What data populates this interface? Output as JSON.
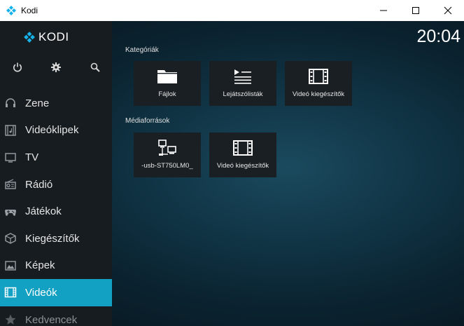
{
  "window": {
    "title": "Kodi",
    "controls": [
      "minimize-icon",
      "maximize-icon",
      "close-icon"
    ]
  },
  "sidebar": {
    "logo_text": "KODI",
    "top_icons": [
      "power-icon",
      "gear-icon",
      "search-icon"
    ],
    "items": [
      {
        "label": "Zene",
        "icon": "headphones-icon"
      },
      {
        "label": "Videóklipek",
        "icon": "music-video-icon"
      },
      {
        "label": "TV",
        "icon": "tv-icon"
      },
      {
        "label": "Rádió",
        "icon": "radio-icon"
      },
      {
        "label": "Játékok",
        "icon": "gamepad-icon"
      },
      {
        "label": "Kiegészítők",
        "icon": "addon-box-icon"
      },
      {
        "label": "Képek",
        "icon": "picture-icon"
      },
      {
        "label": "Videók",
        "icon": "film-icon",
        "active": true
      },
      {
        "label": "Kedvencek",
        "icon": "star-icon"
      }
    ],
    "active_color": "#12a0c3"
  },
  "clock": "20:04",
  "categories": {
    "title": "Kategóriák",
    "tiles": [
      {
        "label": "Fájlok",
        "icon": "folder-icon"
      },
      {
        "label": "Lejátszólisták",
        "icon": "playlist-icon"
      },
      {
        "label": "Videó kiegészítők",
        "icon": "film-icon"
      }
    ]
  },
  "sources": {
    "title": "Médiaforrások",
    "tiles": [
      {
        "label": "-usb-ST750LM0_",
        "icon": "network-drive-icon"
      },
      {
        "label": "Videó kiegészítők",
        "icon": "film-icon"
      }
    ]
  }
}
